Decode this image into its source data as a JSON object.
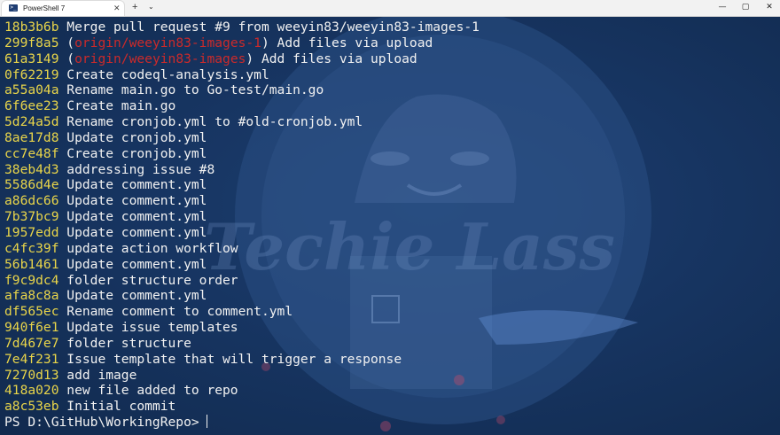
{
  "window": {
    "tab_title": "PowerShell 7",
    "tab_icon": "powershell-icon",
    "tab_close": "✕",
    "new_tab": "+",
    "dropdown": "⌄",
    "minimize": "—",
    "maximize": "▢",
    "close": "✕"
  },
  "terminal": {
    "commits": [
      {
        "hash": "18b3b6b",
        "message": " Merge pull request #9 from weeyin83/weeyin83-images-1"
      },
      {
        "hash": "299f8a5",
        "open": " (",
        "refs": "origin/weeyin83-images-1",
        "close": ")",
        "message": " Add files via upload"
      },
      {
        "hash": "61a3149",
        "open": " (",
        "refs": "origin/weeyin83-images",
        "close": ")",
        "message": " Add files via upload"
      },
      {
        "hash": "0f62219",
        "message": " Create codeql-analysis.yml"
      },
      {
        "hash": "a55a04a",
        "message": " Rename main.go to Go-test/main.go"
      },
      {
        "hash": "6f6ee23",
        "message": " Create main.go"
      },
      {
        "hash": "5d24a5d",
        "message": " Rename cronjob.yml to #old-cronjob.yml"
      },
      {
        "hash": "8ae17d8",
        "message": " Update cronjob.yml"
      },
      {
        "hash": "cc7e48f",
        "message": " Create cronjob.yml"
      },
      {
        "hash": "38eb4d3",
        "message": " addressing issue #8"
      },
      {
        "hash": "5586d4e",
        "message": " Update comment.yml"
      },
      {
        "hash": "a86dc66",
        "message": " Update comment.yml"
      },
      {
        "hash": "7b37bc9",
        "message": " Update comment.yml"
      },
      {
        "hash": "1957edd",
        "message": " Update comment.yml"
      },
      {
        "hash": "c4fc39f",
        "message": " update action workflow"
      },
      {
        "hash": "56b1461",
        "message": " Update comment.yml"
      },
      {
        "hash": "f9c9dc4",
        "message": " folder structure order"
      },
      {
        "hash": "afa8c8a",
        "message": " Update comment.yml"
      },
      {
        "hash": "df565ec",
        "message": " Rename comment to comment.yml"
      },
      {
        "hash": "940f6e1",
        "message": " Update issue templates"
      },
      {
        "hash": "7d467e7",
        "message": " folder structure"
      },
      {
        "hash": "7e4f231",
        "message": " Issue template that will trigger a response"
      },
      {
        "hash": "7270d13",
        "message": " add image"
      },
      {
        "hash": "418a020",
        "message": " new file added to repo"
      },
      {
        "hash": "a8c53eb",
        "message": " Initial commit"
      }
    ],
    "prompt": "PS D:\\GitHub\\WorkingRepo>"
  },
  "colors": {
    "hash": "#e9d54a",
    "ref": "#cc2a2a",
    "text": "#f2f2f2",
    "background": "#15325c"
  },
  "wallpaper": {
    "logo_text": "Techie Lass"
  }
}
